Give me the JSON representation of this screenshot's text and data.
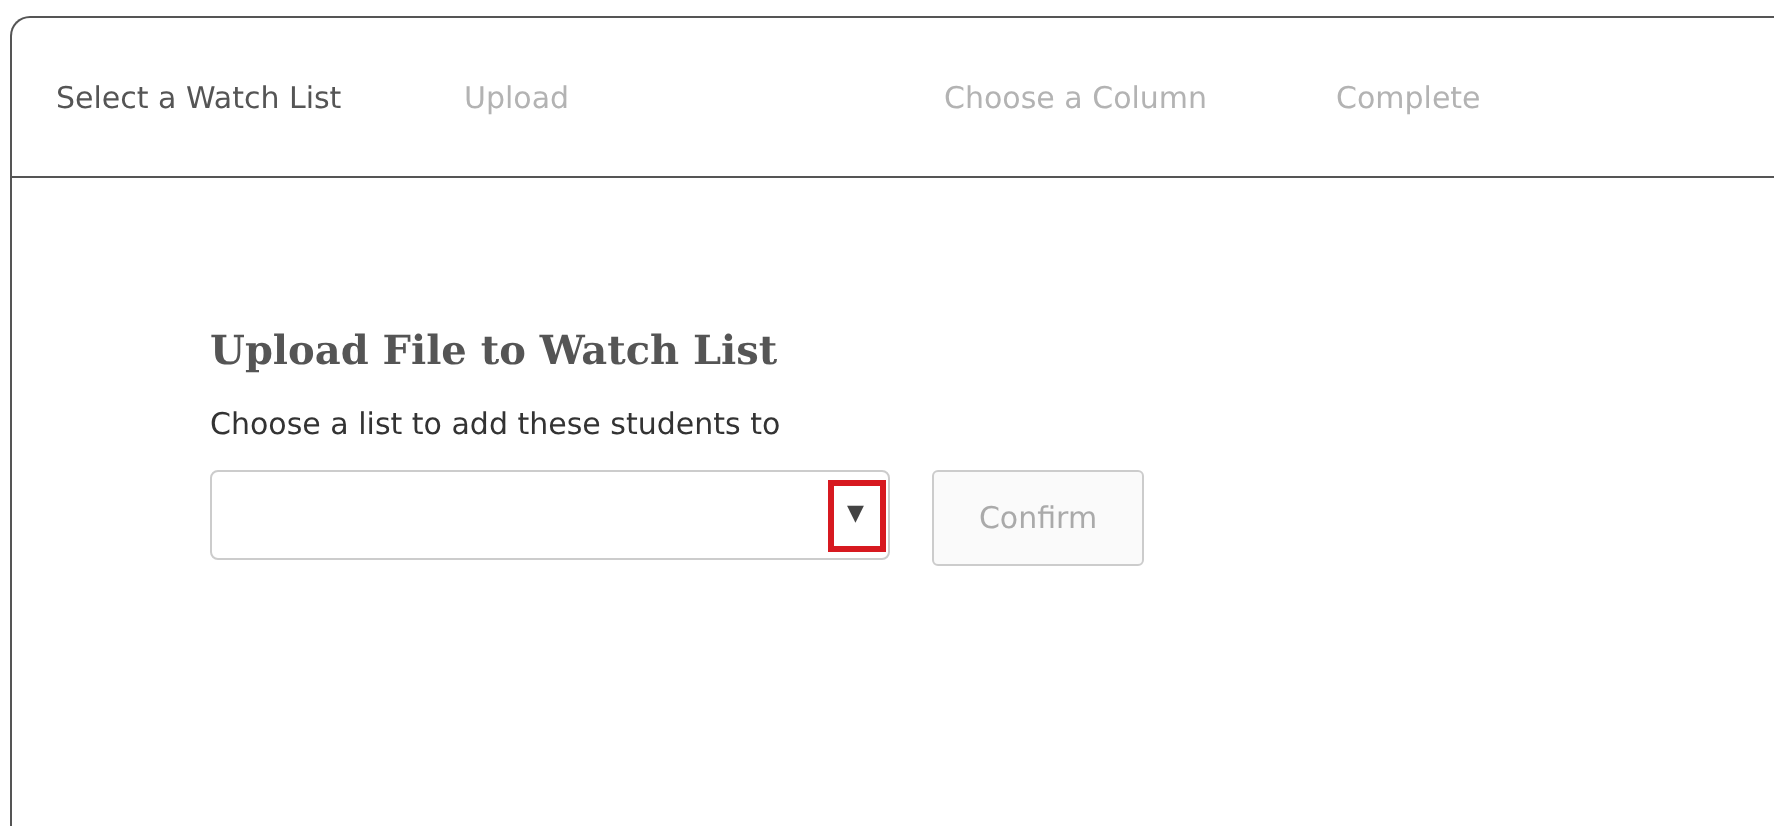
{
  "tabs": [
    {
      "label": "Select a Watch List",
      "selected": true
    },
    {
      "label": "Upload",
      "selected": false
    },
    {
      "label": "Choose a Column",
      "selected": false
    },
    {
      "label": "Complete",
      "selected": false
    }
  ],
  "heading": "Upload File to Watch List",
  "prompt": "Choose a list to add these students to",
  "list_select": {
    "caret": "▼",
    "highlighted": true
  },
  "confirm_button": {
    "label": "Confirm",
    "disabled": true
  }
}
